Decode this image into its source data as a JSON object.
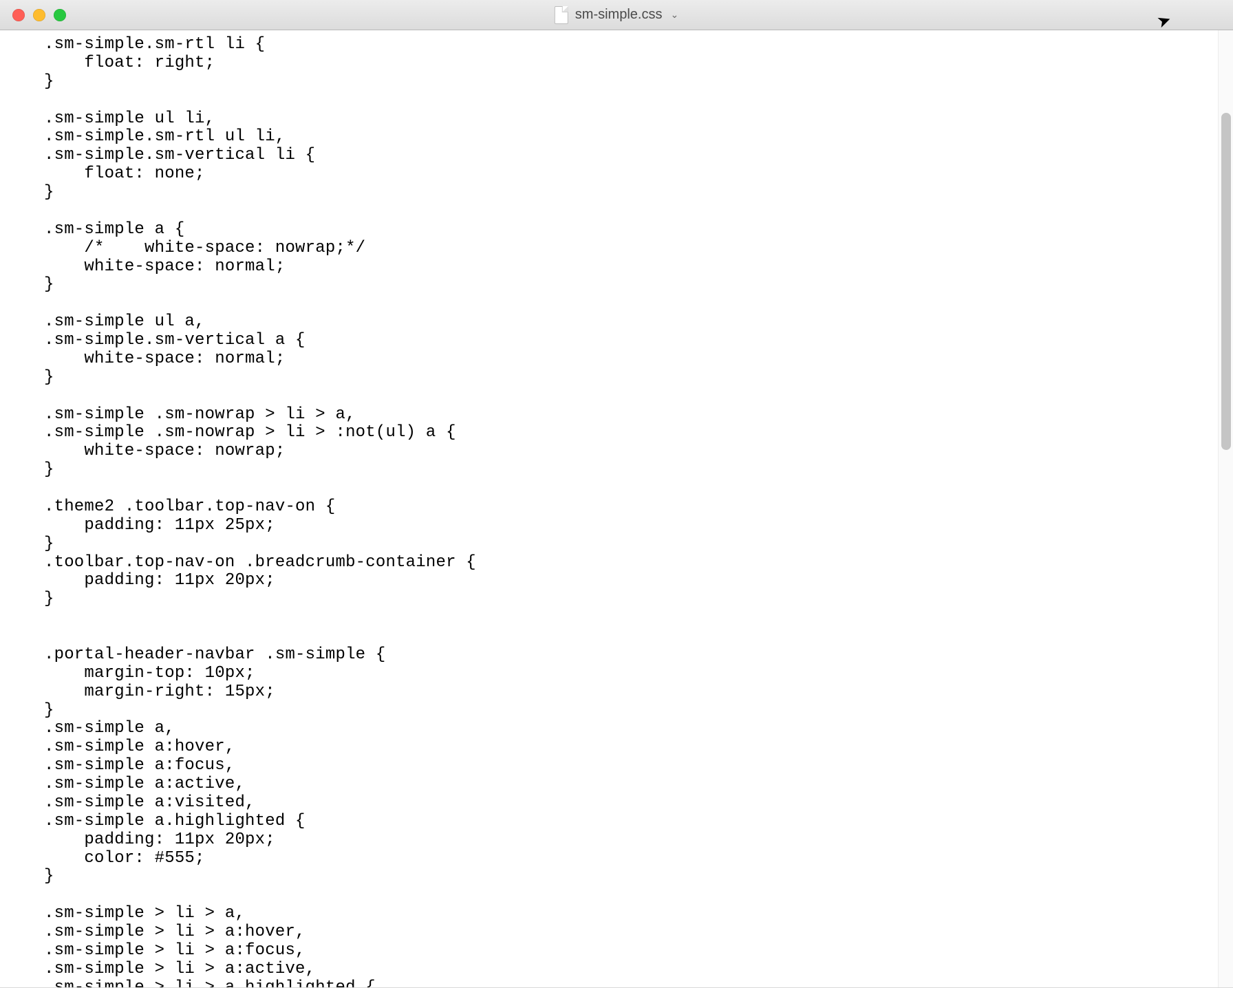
{
  "window": {
    "filename": "sm-simple.css"
  },
  "code_lines": [
    ".sm-simple.sm-rtl li {",
    "    float: right;",
    "}",
    "",
    ".sm-simple ul li,",
    ".sm-simple.sm-rtl ul li,",
    ".sm-simple.sm-vertical li {",
    "    float: none;",
    "}",
    "",
    ".sm-simple a {",
    "    /*    white-space: nowrap;*/",
    "    white-space: normal;",
    "}",
    "",
    ".sm-simple ul a,",
    ".sm-simple.sm-vertical a {",
    "    white-space: normal;",
    "}",
    "",
    ".sm-simple .sm-nowrap > li > a,",
    ".sm-simple .sm-nowrap > li > :not(ul) a {",
    "    white-space: nowrap;",
    "}",
    "",
    ".theme2 .toolbar.top-nav-on {",
    "    padding: 11px 25px;",
    "}",
    ".toolbar.top-nav-on .breadcrumb-container {",
    "    padding: 11px 20px;",
    "}",
    "",
    "",
    ".portal-header-navbar .sm-simple {",
    "    margin-top: 10px;",
    "    margin-right: 15px;",
    "}",
    ".sm-simple a,",
    ".sm-simple a:hover,",
    ".sm-simple a:focus,",
    ".sm-simple a:active,",
    ".sm-simple a:visited,",
    ".sm-simple a.highlighted {",
    "    padding: 11px 20px;",
    "    color: #555;",
    "}",
    "",
    ".sm-simple > li > a,",
    ".sm-simple > li > a:hover,",
    ".sm-simple > li > a:focus,",
    ".sm-simple > li > a:active,",
    ".sm-simple > li > a.highlighted {"
  ]
}
